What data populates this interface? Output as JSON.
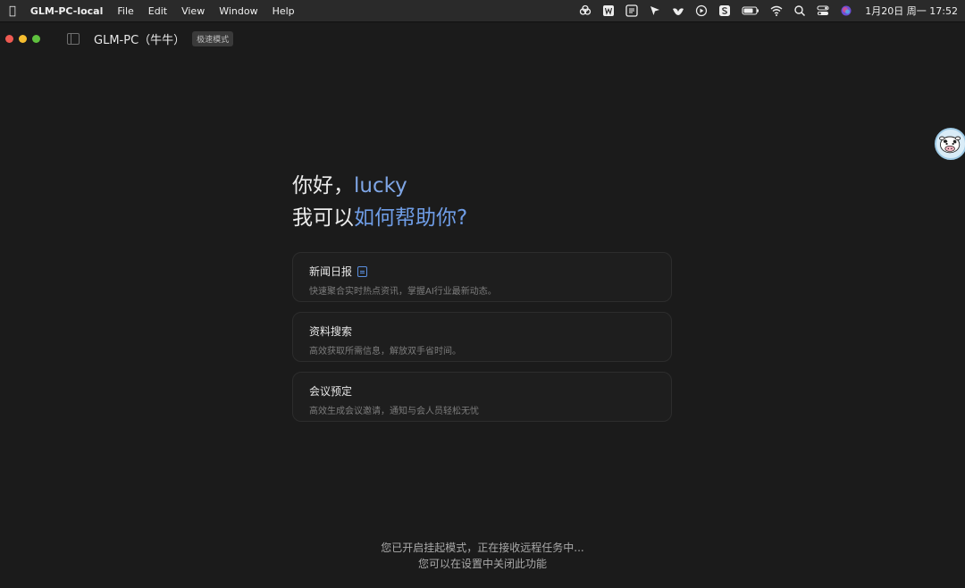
{
  "menubar": {
    "app_name": "GLM-PC-local",
    "menus": [
      "File",
      "Edit",
      "View",
      "Window",
      "Help"
    ],
    "status_icons": [
      "creative-cloud-icon",
      "word-icon",
      "scan-icon",
      "cursor-icon",
      "bird-icon",
      "play-icon",
      "script-icon",
      "battery-icon",
      "wifi-icon",
      "search-icon",
      "control-center-icon",
      "siri-icon"
    ],
    "clock": "1月20日 周一  17:52"
  },
  "window": {
    "title": "GLM-PC（牛牛）",
    "mode_badge": "极速模式"
  },
  "greeting": {
    "hello": "你好，",
    "user": "lucky",
    "question_a": "我可以",
    "question_b": "如何帮助你?"
  },
  "cards": [
    {
      "title": "新闻日报",
      "desc": "快速聚合实时热点资讯，掌握AI行业最新动态。",
      "has_icon": true
    },
    {
      "title": "资料搜索",
      "desc": "高效获取所需信息，解放双手省时间。"
    },
    {
      "title": "会议预定",
      "desc": "高效生成会议邀请，通知与会人员轻松无忧"
    }
  ],
  "notice": {
    "line1": "您已开启挂起模式，正在接收远程任务中...",
    "line2": "您可以在设置中关闭此功能"
  }
}
